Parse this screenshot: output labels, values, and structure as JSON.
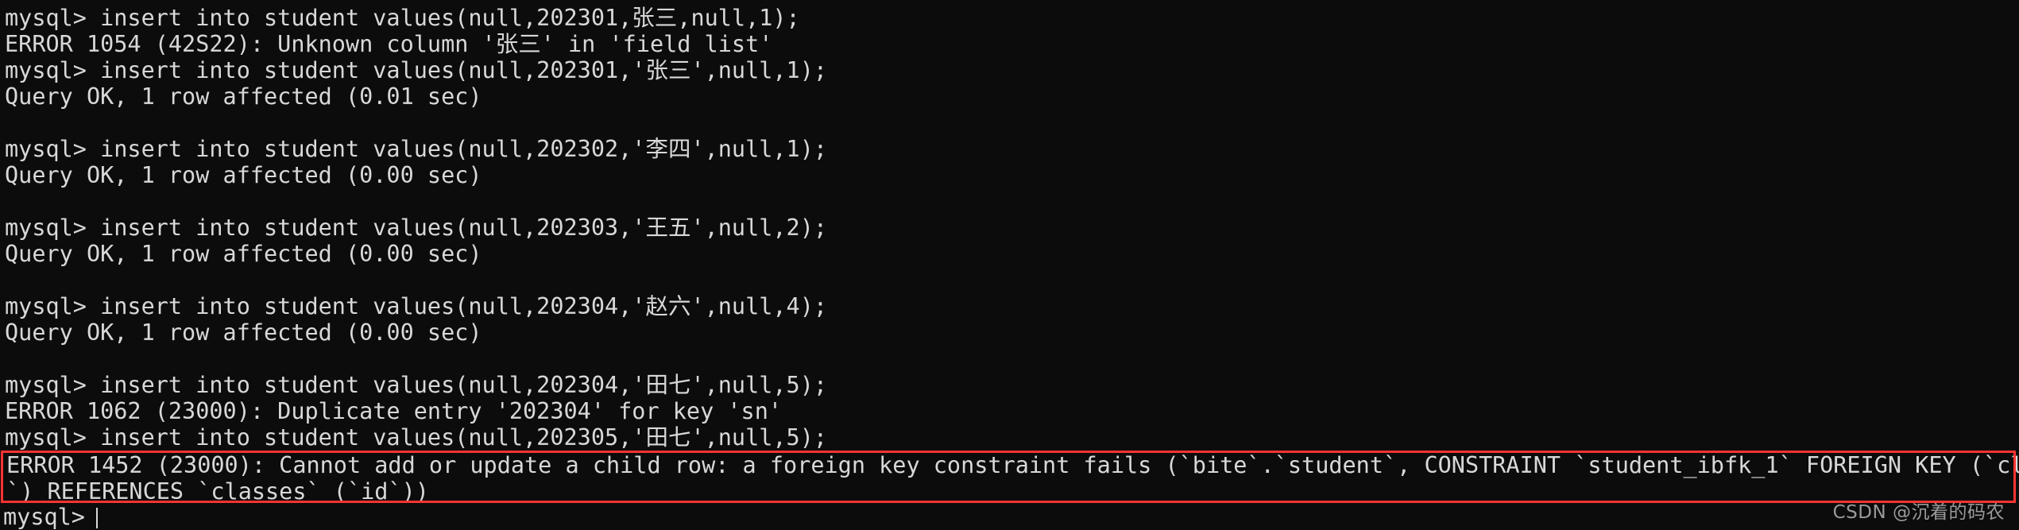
{
  "terminal": {
    "type": "mysql-client-console",
    "theme": {
      "background": "#0c0c0c",
      "foreground": "#d8d8d8",
      "highlight_border": "#ff3333",
      "watermark_color": "#9a9a9a"
    },
    "prompt": "mysql>",
    "lines": [
      "mysql> insert into student values(null,202301,张三,null,1);",
      "ERROR 1054 (42S22): Unknown column '张三' in 'field list'",
      "mysql> insert into student values(null,202301,'张三',null,1);",
      "Query OK, 1 row affected (0.01 sec)",
      "",
      "mysql> insert into student values(null,202302,'李四',null,1);",
      "Query OK, 1 row affected (0.00 sec)",
      "",
      "mysql> insert into student values(null,202303,'王五',null,2);",
      "Query OK, 1 row affected (0.00 sec)",
      "",
      "mysql> insert into student values(null,202304,'赵六',null,4);",
      "Query OK, 1 row affected (0.00 sec)",
      "",
      "mysql> insert into student values(null,202304,'田七',null,5);",
      "ERROR 1062 (23000): Duplicate entry '202304' for key 'sn'",
      "mysql> insert into student values(null,202305,'田七',null,5);"
    ],
    "highlighted_error": {
      "line1": "ERROR 1452 (23000): Cannot add or update a child row: a foreign key constraint fails (`bite`.`student`, CONSTRAINT `student_ibfk_1` FOREIGN KEY (`classes_id",
      "line2": "`) REFERENCES `classes` (`id`))"
    },
    "final_prompt": "mysql>",
    "cursor_visible": true
  },
  "watermark": {
    "text": "CSDN @沉着的码农"
  }
}
